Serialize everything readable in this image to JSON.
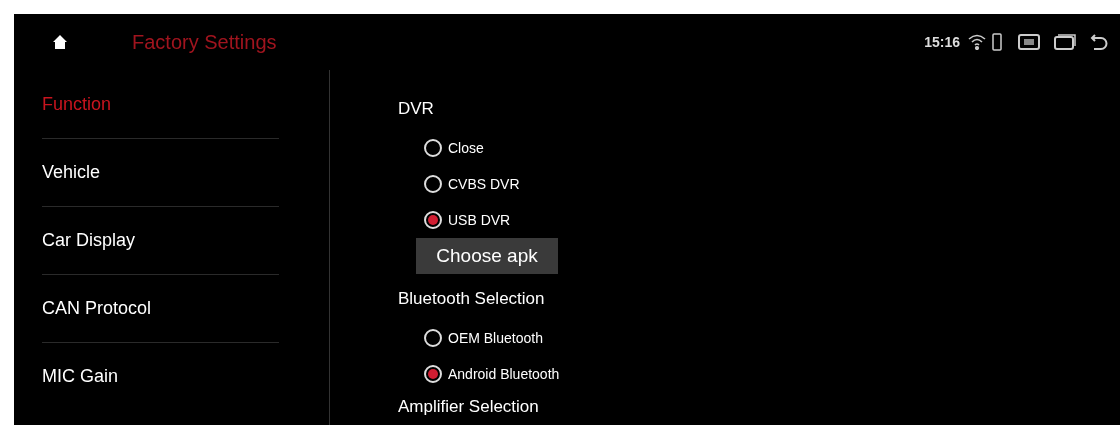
{
  "header": {
    "title": "Factory Settings",
    "time": "15:16"
  },
  "sidebar": {
    "items": [
      {
        "label": "Function",
        "selected": true
      },
      {
        "label": "Vehicle",
        "selected": false
      },
      {
        "label": "Car Display",
        "selected": false
      },
      {
        "label": "CAN Protocol",
        "selected": false
      },
      {
        "label": "MIC Gain",
        "selected": false
      }
    ]
  },
  "sections": [
    {
      "title": "DVR",
      "options": [
        {
          "label": "Close",
          "selected": false
        },
        {
          "label": "CVBS DVR",
          "selected": false
        },
        {
          "label": "USB DVR",
          "selected": true
        }
      ],
      "button": "Choose apk"
    },
    {
      "title": "Bluetooth Selection",
      "options": [
        {
          "label": "OEM Bluetooth",
          "selected": false
        },
        {
          "label": "Android Bluetooth",
          "selected": true
        }
      ]
    },
    {
      "title": "Amplifier Selection"
    }
  ]
}
